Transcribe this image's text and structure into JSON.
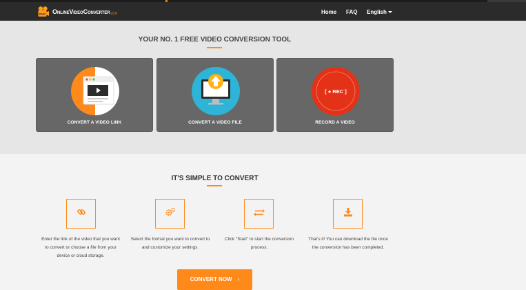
{
  "nav": {
    "logo_text": "OnlineVideoConverter",
    "logo_version": "v3.0",
    "links": [
      "Home",
      "FAQ",
      "English"
    ]
  },
  "hero": {
    "title": "YOUR NO. 1 FREE VIDEO CONVERSION TOOL",
    "cards": [
      {
        "label": "CONVERT A VIDEO LINK",
        "icon": "browser-video-icon"
      },
      {
        "label": "CONVERT A VIDEO FILE",
        "icon": "monitor-upload-icon"
      },
      {
        "label": "RECORD A VIDEO",
        "icon": "record-icon",
        "badge": "[ ● REC ]"
      }
    ]
  },
  "steps": {
    "title": "IT'S SIMPLE TO CONVERT",
    "items": [
      {
        "icon": "link-icon",
        "text": "Enter the link of the video that you want to convert or choose a file from your device or cloud storage."
      },
      {
        "icon": "gears-icon",
        "text": "Select the format you want to convert to and customize your settings."
      },
      {
        "icon": "exchange-icon",
        "text": "Click \"Start\" to start the conversion process."
      },
      {
        "icon": "download-icon",
        "text": "That's it! You can download the file once the conversion has been completed."
      }
    ],
    "cta_label": "CONVERT NOW",
    "cta_arrow": "›"
  },
  "colors": {
    "accent": "#ff8a1a",
    "navbar": "#2b2b2b",
    "card": "#676767",
    "rec_red": "#e43218",
    "upload_blue": "#2fb3d6"
  }
}
